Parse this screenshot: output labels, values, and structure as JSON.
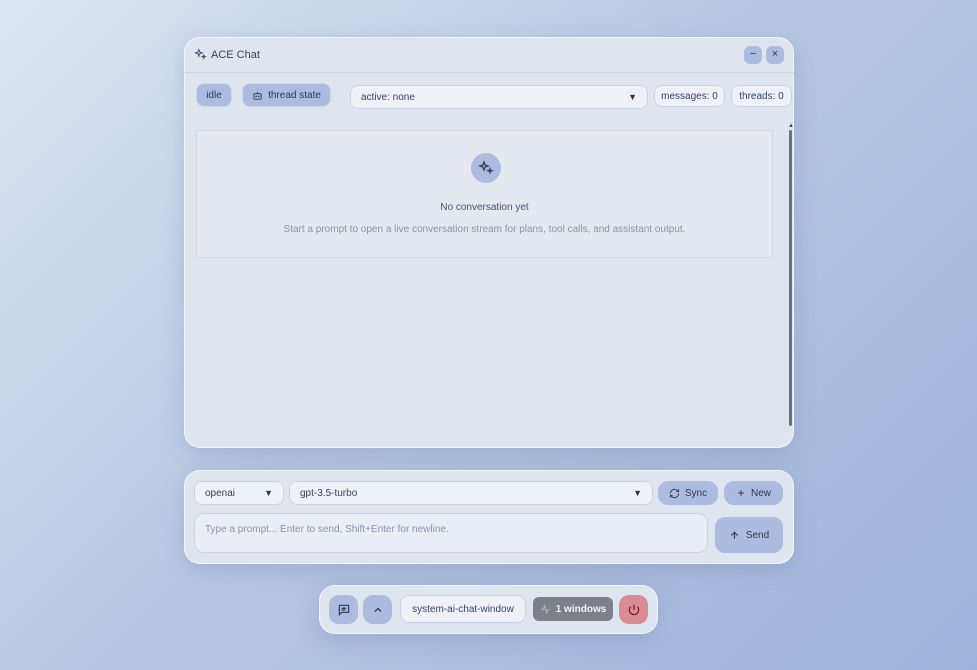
{
  "window": {
    "title": "ACE Chat",
    "minimize_label": "−",
    "close_label": "×"
  },
  "toolbar": {
    "status_label": "idle",
    "thread_state_label": "thread state",
    "active_select": "active: none",
    "messages_label": "messages: 0",
    "threads_label": "threads: 0"
  },
  "empty_state": {
    "title": "No conversation yet",
    "subtitle": "Start a prompt to open a live conversation stream for plans, tool calls, and assistant output."
  },
  "composer": {
    "provider": "openai",
    "model": "gpt-3.5-turbo",
    "sync_label": "Sync",
    "new_label": "New",
    "prompt_placeholder": "Type a prompt... Enter to send, Shift+Enter for newline.",
    "send_label": "Send"
  },
  "dock": {
    "window_label": "system-ai-chat-window",
    "windows_count": "1 windows"
  },
  "icons": {
    "title": "sparkles-icon",
    "thread_state": "robot-icon",
    "sync": "refresh-icon",
    "new": "plus-icon",
    "send": "arrow-up-icon",
    "dock_chat": "chat-icon",
    "dock_expand": "chevron-up-icon",
    "dock_activity": "activity-icon",
    "dock_power": "power-icon"
  },
  "colors": {
    "accent": "#aebbe0",
    "panel": "#dfe5ef",
    "power": "#d98c96",
    "windows_badge": "#7d808a"
  }
}
